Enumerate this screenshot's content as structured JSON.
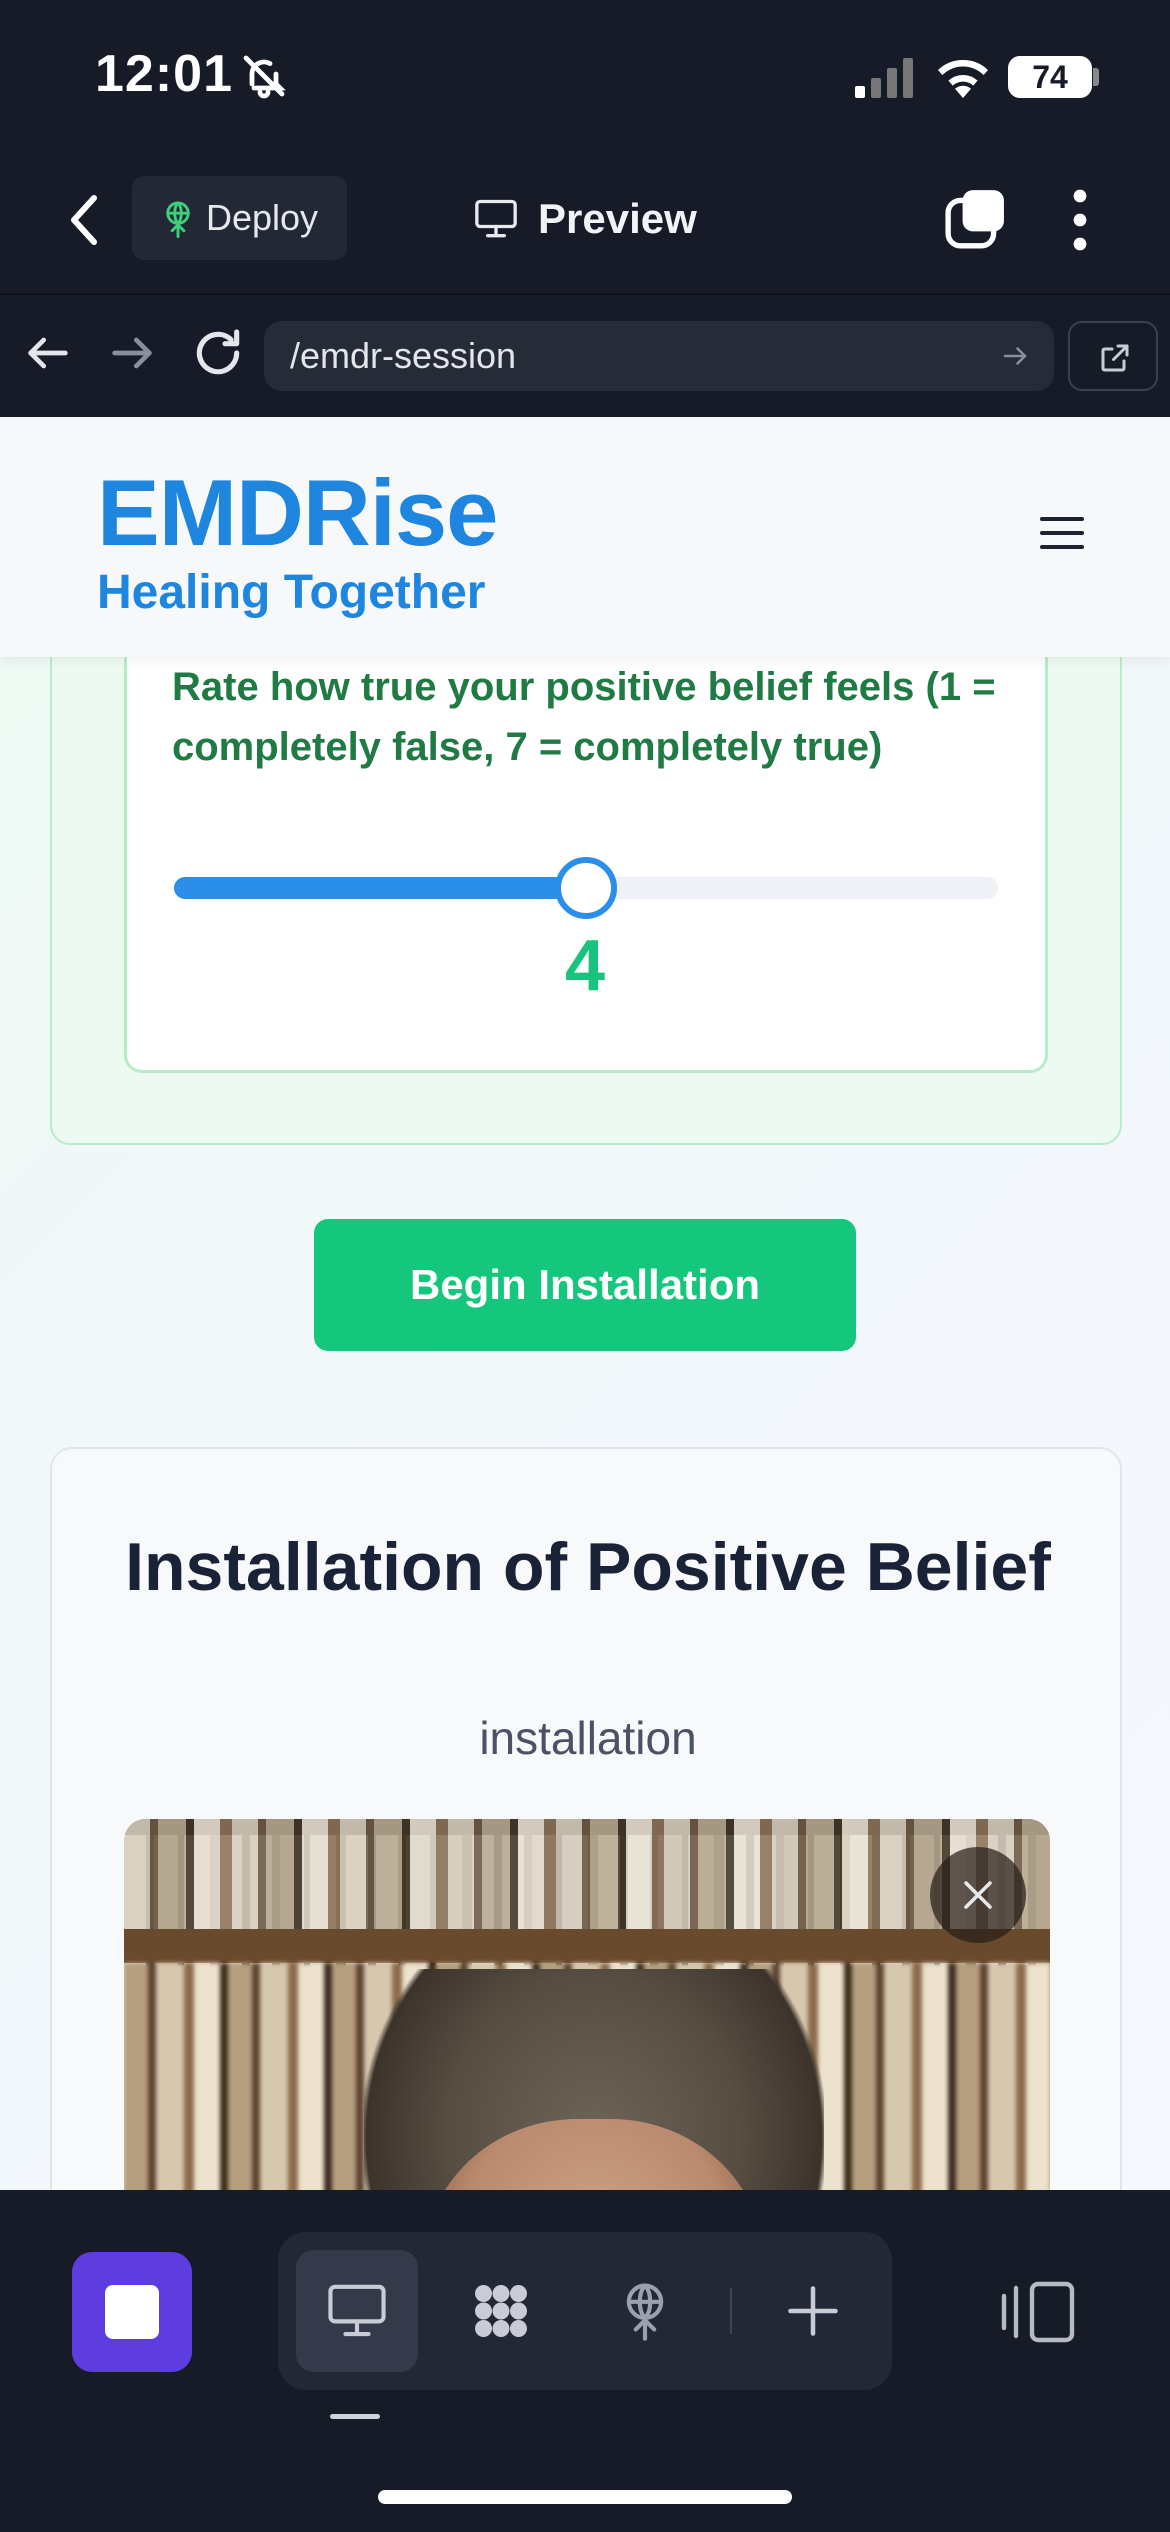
{
  "status_bar": {
    "time": "12:01",
    "battery": "74"
  },
  "toolbar": {
    "deploy_label": "Deploy",
    "preview_label": "Preview"
  },
  "url_bar": {
    "path": "/emdr-session"
  },
  "site": {
    "brand": "EMDRise",
    "tagline": "Healing Together"
  },
  "rating": {
    "prompt": "Rate how true your positive belief feels (1 = completely false, 7 = completely true)",
    "value": "4",
    "min": 1,
    "max": 7,
    "current": 4
  },
  "actions": {
    "begin_label": "Begin Installation"
  },
  "installation": {
    "title": "Installation of Positive Belief",
    "subtitle": "installation"
  },
  "colors": {
    "brand_blue": "#1f86e0",
    "accent_green": "#14c77d",
    "dock_purple": "#5d3de0"
  },
  "icons": {
    "dock": [
      "desktop-icon",
      "apps-icon",
      "deploy-icon",
      "plus-icon"
    ]
  }
}
